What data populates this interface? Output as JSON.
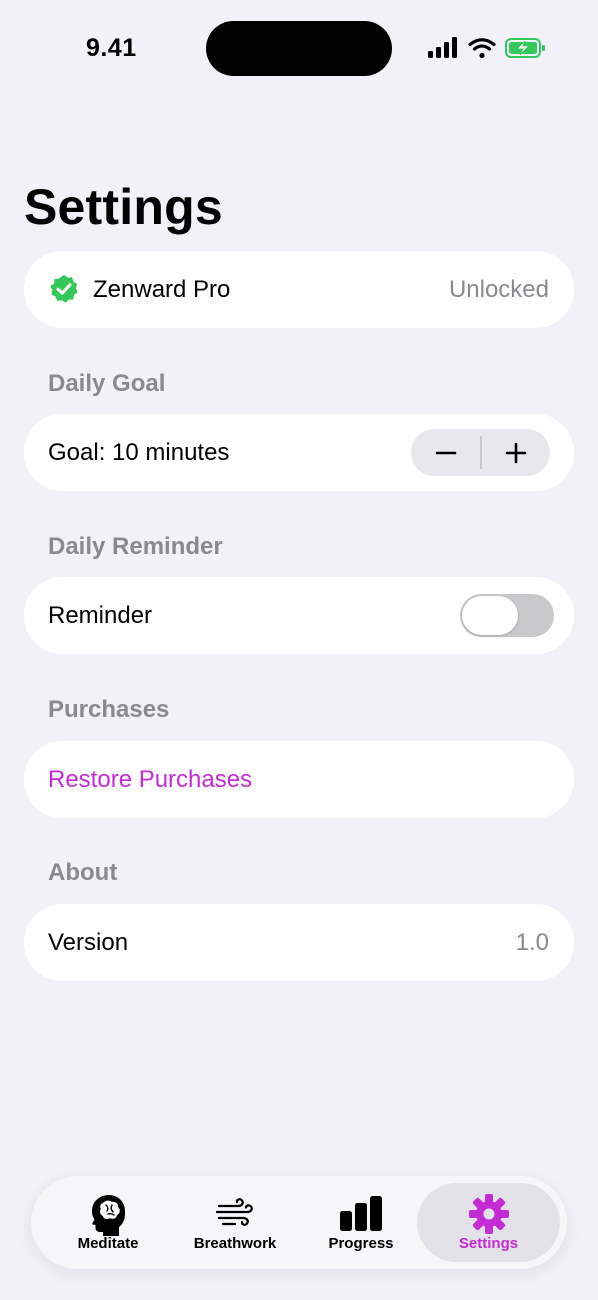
{
  "status_bar": {
    "time": "9.41",
    "icons": [
      "signal-icon",
      "wifi-icon",
      "battery-charging-icon"
    ]
  },
  "page": {
    "title": "Settings"
  },
  "pro": {
    "label": "Zenward Pro",
    "status": "Unlocked",
    "badge_icon": "verified-badge-icon"
  },
  "daily_goal": {
    "header": "Daily Goal",
    "label": "Goal: 10 minutes",
    "decrement_icon": "minus-icon",
    "increment_icon": "plus-icon"
  },
  "daily_reminder": {
    "header": "Daily Reminder",
    "label": "Reminder",
    "enabled": false
  },
  "purchases": {
    "header": "Purchases",
    "restore_label": "Restore Purchases"
  },
  "about": {
    "header": "About",
    "version_label": "Version",
    "version_value": "1.0"
  },
  "tab_bar": {
    "tabs": [
      {
        "label": "Meditate",
        "icon": "head-brain-icon",
        "active": false
      },
      {
        "label": "Breathwork",
        "icon": "wind-icon",
        "active": false
      },
      {
        "label": "Progress",
        "icon": "bar-chart-icon",
        "active": false
      },
      {
        "label": "Settings",
        "icon": "gear-icon",
        "active": true
      }
    ]
  },
  "colors": {
    "accent": "#c42bd4",
    "background": "#f2f1f7",
    "card": "#ffffff",
    "secondary_text": "#8a8a8e",
    "badge_green": "#34c759"
  }
}
